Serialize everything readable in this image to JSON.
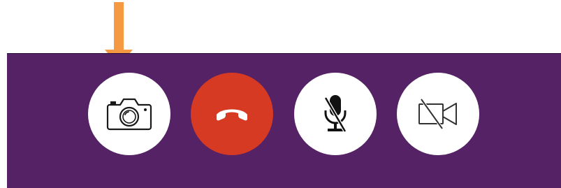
{
  "call_bar": {
    "background_color": "#542265",
    "controls": [
      {
        "id": "camera",
        "icon": "camera-icon",
        "background_color": "#ffffff"
      },
      {
        "id": "hangup",
        "icon": "phone-hangup-icon",
        "background_color": "#d63a22"
      },
      {
        "id": "mic",
        "icon": "microphone-muted-icon",
        "background_color": "#ffffff"
      },
      {
        "id": "video",
        "icon": "video-off-icon",
        "background_color": "#ffffff"
      }
    ]
  },
  "annotation": {
    "icon": "arrow-down-icon",
    "color": "#f59a42"
  }
}
